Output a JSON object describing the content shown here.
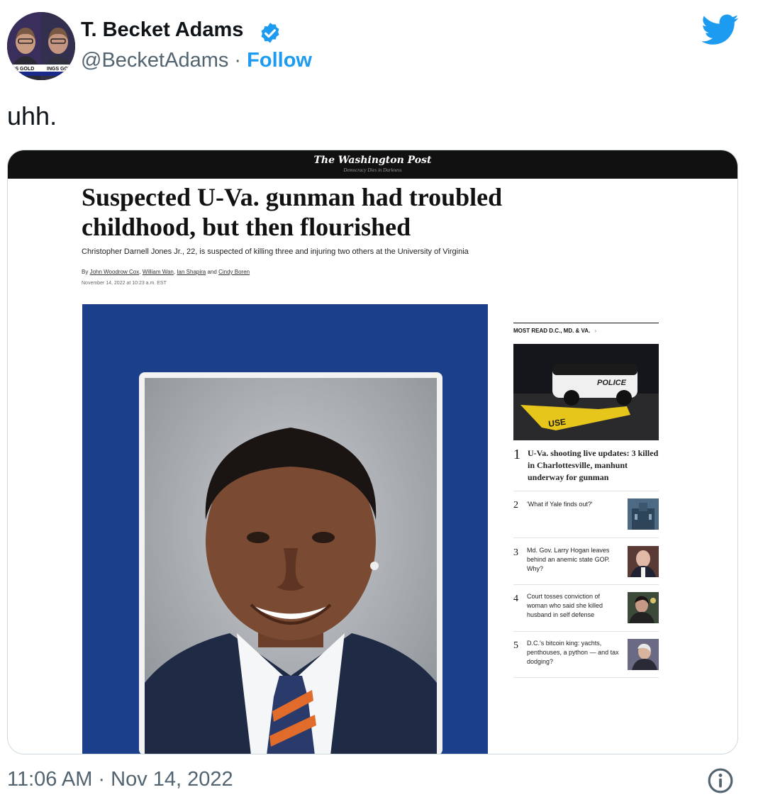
{
  "author": {
    "name": "T. Becket Adams",
    "handle": "@BecketAdams",
    "separator": "·",
    "follow_label": "Follow",
    "avatar_caption_left": "GS GOLD",
    "avatar_caption_right": "INGS GOL"
  },
  "tweet": {
    "text": "uhh.",
    "timestamp": "11:06 AM · Nov 14, 2022"
  },
  "article": {
    "logo": "The Washington Post",
    "tagline": "Democracy Dies in Darkness",
    "headline": "Suspected U-Va. gunman had troubled childhood, but then flourished",
    "subhead": "Christopher Darnell Jones Jr., 22, is suspected of killing three and injuring two others at the University of Virginia",
    "byline_prefix": "By",
    "authors": [
      "John Woodrow Cox",
      "William Wan",
      "Ian Shapira",
      "Cindy Boren"
    ],
    "byline_and": "and",
    "date": "November 14, 2022 at 10:23 a.m. EST"
  },
  "most_read": {
    "heading": "MOST READ D.C., MD. & VA.",
    "chevron": "›",
    "photo_text_police": "POLICE",
    "photo_text_tape": "USE",
    "items": [
      {
        "number": "1",
        "title": "U-Va. shooting live updates: 3 killed in Charlottesville, manhunt underway for gunman"
      },
      {
        "number": "2",
        "title": "'What if Yale finds out?'"
      },
      {
        "number": "3",
        "title": "Md. Gov. Larry Hogan leaves behind an anemic state GOP. Why?"
      },
      {
        "number": "4",
        "title": "Court tosses conviction of woman who said she killed husband in self defense"
      },
      {
        "number": "5",
        "title": "D.C.'s bitcoin king: yachts, penthouses, a python — and tax dodging?"
      }
    ]
  },
  "icons": {
    "verified": "verified-badge-icon",
    "twitter": "twitter-bird-icon",
    "info": "info-icon"
  },
  "colors": {
    "accent": "#1d9bf0",
    "secondary_text": "#536471",
    "photo_backdrop": "#1c3f8c"
  }
}
